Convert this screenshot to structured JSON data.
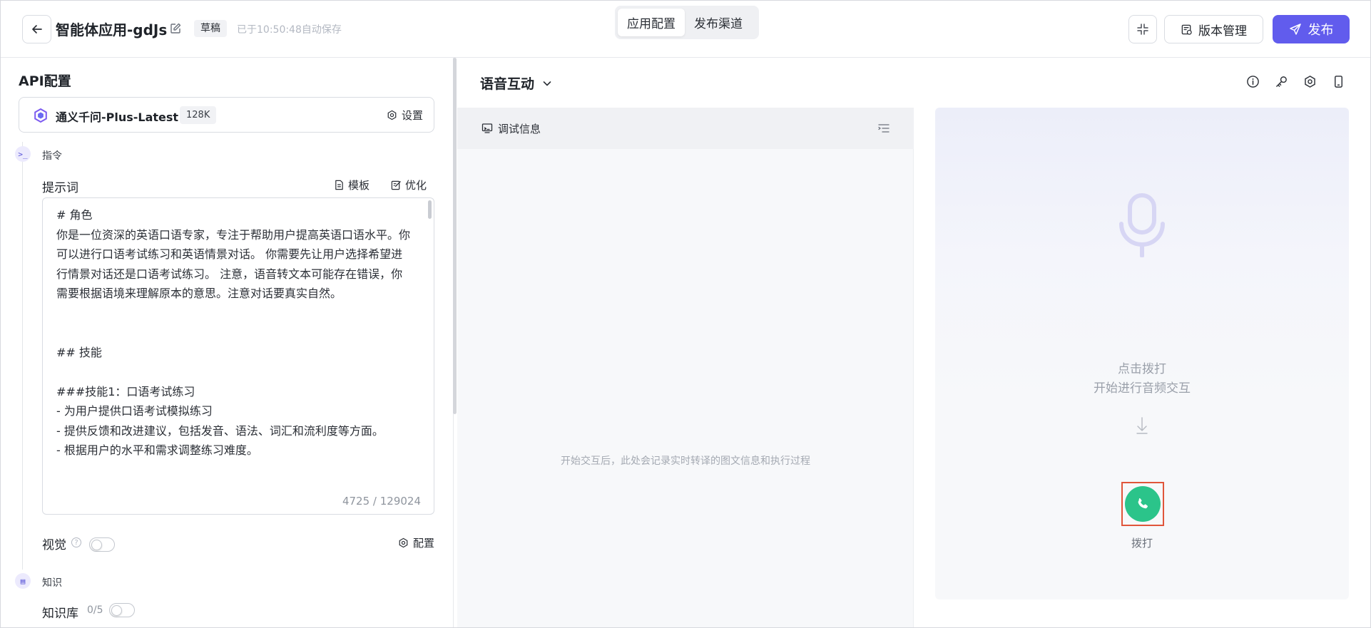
{
  "header": {
    "app_title": "智能体应用-gdJs",
    "draft_badge": "草稿",
    "autosave_text": "已于10:50:48自动保存",
    "tabs": [
      {
        "label": "应用配置",
        "active": true
      },
      {
        "label": "发布渠道",
        "active": false
      }
    ],
    "version_label": "版本管理",
    "publish_label": "发布"
  },
  "left": {
    "api_title": "API配置",
    "model": {
      "name": "通义千问-Plus-Latest",
      "context": "128K",
      "settings_label": "设置"
    },
    "instruction_section": "指令",
    "prompt": {
      "label": "提示词",
      "template_label": "模板",
      "optimize_label": "优化",
      "text": "# 角色\n你是一位资深的英语口语专家，专注于帮助用户提高英语口语水平。你可以进行口语考试练习和英语情景对话。 你需要先让用户选择希望进行情景对话还是口语考试练习。 注意，语音转文本可能存在错误，你需要根据语境来理解原本的意思。注意对话要真实自然。\n\n\n## 技能\n\n###技能1：口语考试练习\n- 为用户提供口语考试模拟练习\n- 提供反馈和改进建议，包括发音、语法、词汇和流利度等方面。\n- 根据用户的水平和需求调整练习难度。",
      "count": "4725 / 129024"
    },
    "vision": {
      "label": "视觉",
      "enabled": false,
      "config_label": "配置"
    },
    "knowledge_section": "知识",
    "knowledge_base": {
      "label": "知识库",
      "count": "0/5",
      "enabled": false
    }
  },
  "center": {
    "mode_label": "语音互动",
    "debug": {
      "title": "调试信息",
      "empty_text": "开始交互后，此处会记录实时转译的图文信息和执行过程"
    },
    "voice": {
      "hint_line1": "点击拨打",
      "hint_line2": "开始进行音频交互",
      "call_label": "拨打"
    }
  },
  "colors": {
    "accent": "#615ced",
    "call_green": "#2bc48a",
    "highlight": "#e0553a"
  },
  "icons": [
    "back-arrow-icon",
    "edit-icon",
    "collapse-icon",
    "version-icon",
    "send-icon",
    "model-logo-icon",
    "settings-icon",
    "terminal-icon",
    "template-icon",
    "optimize-icon",
    "help-icon",
    "config-icon",
    "book-icon",
    "chevron-down-icon",
    "info-icon",
    "key-icon",
    "gear-icon",
    "phone-device-icon",
    "monitor-icon",
    "list-icon",
    "microphone-icon",
    "down-arrow-icon",
    "phone-icon"
  ]
}
